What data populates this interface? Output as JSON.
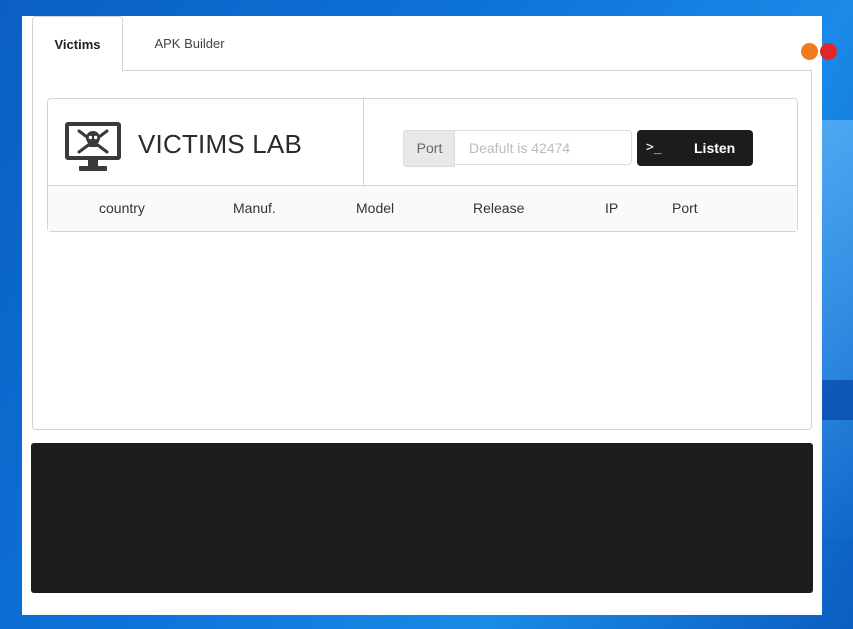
{
  "window": {
    "tabs": [
      {
        "label": "Victims",
        "active": true
      },
      {
        "label": "APK Builder",
        "active": false
      }
    ],
    "controls": {
      "minimize_color": "#f27b1d",
      "close_color": "#e0262a"
    }
  },
  "header": {
    "title": "VICTIMS LAB",
    "logo_icon": "monitor-skull-icon"
  },
  "port_form": {
    "label": "Port",
    "placeholder": "Deafult is 42474",
    "value": ""
  },
  "listen_button": {
    "icon": ">_",
    "label": "Listen"
  },
  "table": {
    "columns": [
      "country",
      "Manuf.",
      "Model",
      "Release",
      "IP",
      "Port"
    ],
    "rows": []
  },
  "console": {
    "lines": []
  }
}
